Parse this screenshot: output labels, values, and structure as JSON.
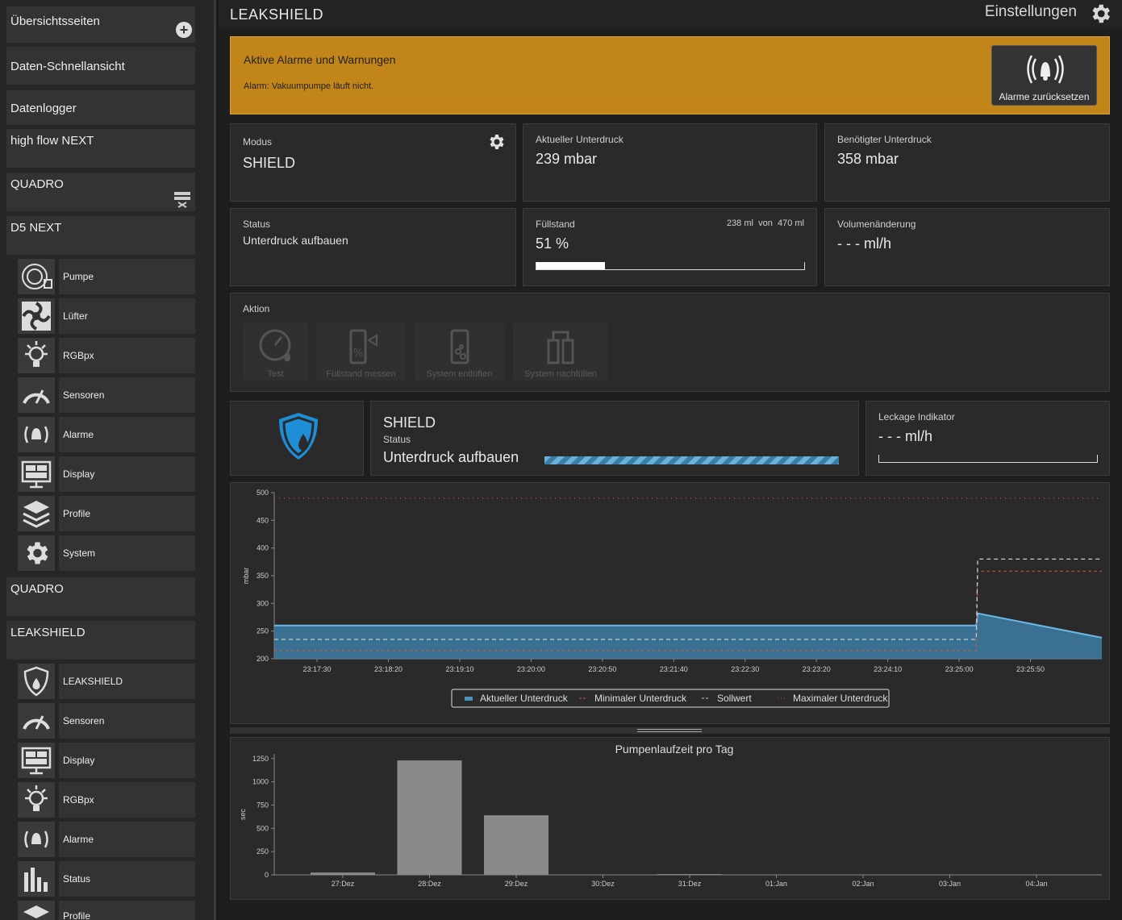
{
  "sidebar": {
    "top": [
      "Übersichtsseiten",
      "Daten-Schnellansicht",
      "Datenlogger",
      "high flow NEXT",
      "QUADRO",
      "D5 NEXT"
    ],
    "d5": [
      "Pumpe",
      "Lüfter",
      "RGBpx",
      "Sensoren",
      "Alarme",
      "Display",
      "Profile",
      "System"
    ],
    "mid": [
      "QUADRO",
      "LEAKSHIELD"
    ],
    "ls": [
      "LEAKSHIELD",
      "Sensoren",
      "Display",
      "RGBpx",
      "Alarme",
      "Status",
      "Profile"
    ]
  },
  "header": {
    "title": "LEAKSHIELD",
    "settings": "Einstellungen"
  },
  "alarm": {
    "heading": "Aktive Alarme und Warnungen",
    "text": "Alarm: Vakuumpumpe läuft nicht.",
    "button": "Alarme zurücksetzen",
    "color": "#c2851a"
  },
  "cards": {
    "modus": {
      "label": "Modus",
      "value": "SHIELD"
    },
    "current": {
      "label": "Aktueller Unterdruck",
      "value": "239 mbar"
    },
    "required": {
      "label": "Benötigter Unterdruck",
      "value": "358 mbar"
    },
    "status": {
      "label": "Status",
      "value": "Unterdruck aufbauen"
    },
    "fill": {
      "label": "Füllstand",
      "value": "51 %",
      "ml": "238 ml",
      "von": "von",
      "total": "470 ml",
      "fraction": 0.51
    },
    "volume": {
      "label": "Volumenänderung",
      "value": "- - - ml/h"
    }
  },
  "actions": {
    "label": "Aktion",
    "items": [
      "Test",
      "Füllstand messen",
      "System entlüften",
      "System nachfüllen"
    ]
  },
  "shield": {
    "title": "SHIELD",
    "status_label": "Status",
    "status": "Unterdruck aufbauen",
    "leak_label": "Leckage Indikator",
    "leak_value": "- - - ml/h"
  },
  "chart_data": [
    {
      "type": "area",
      "ylabel": "mbar",
      "ylim": [
        200,
        500
      ],
      "yticks": [
        "500",
        "450",
        "400",
        "350",
        "300",
        "250",
        "200"
      ],
      "xticks": [
        "23:17:30",
        "23:18:20",
        "23:19:10",
        "23:20:00",
        "23:20:50",
        "23:21:40",
        "23:22:30",
        "23:23:20",
        "23:24:10",
        "23:25:00",
        "23:25:50"
      ],
      "legend": [
        "Aktueller Unterdruck",
        "Minimaler Unterdruck",
        "Sollwert",
        "Maximaler Unterdruck"
      ],
      "legend_position": "bottom",
      "series": [
        {
          "name": "Aktueller Unterdruck",
          "x": [
            "23:17:00",
            "23:25:12",
            "23:25:13",
            "23:26:40"
          ],
          "values": [
            260,
            260,
            282,
            238
          ],
          "color": "#4a90b8"
        },
        {
          "name": "Minimaler Unterdruck",
          "x": [
            "23:17:00",
            "23:25:12",
            "23:25:13",
            "23:26:40"
          ],
          "values": [
            215,
            215,
            358,
            358
          ],
          "color": "#c85a3a"
        },
        {
          "name": "Sollwert",
          "x": [
            "23:17:00",
            "23:25:12",
            "23:25:13",
            "23:26:40"
          ],
          "values": [
            235,
            235,
            380,
            380
          ],
          "color": "#cccccc"
        },
        {
          "name": "Maximaler Unterdruck",
          "x": [
            "23:17:00",
            "23:26:40"
          ],
          "values": [
            490,
            490
          ],
          "color": "#c85a3a"
        }
      ]
    },
    {
      "type": "bar",
      "title": "Pumpenlaufzeit pro Tag",
      "ylabel": "sec",
      "ylim": [
        0,
        1300
      ],
      "yticks": [
        "1250",
        "1000",
        "750",
        "500",
        "250",
        "0"
      ],
      "categories": [
        "27:Dez",
        "28:Dez",
        "29:Dez",
        "30:Dez",
        "31:Dez",
        "01:Jan",
        "02:Jan",
        "03:Jan",
        "04:Jan"
      ],
      "values": [
        25,
        1230,
        640,
        0,
        8,
        0,
        0,
        0,
        0
      ],
      "color": "#8a8a8a"
    }
  ]
}
